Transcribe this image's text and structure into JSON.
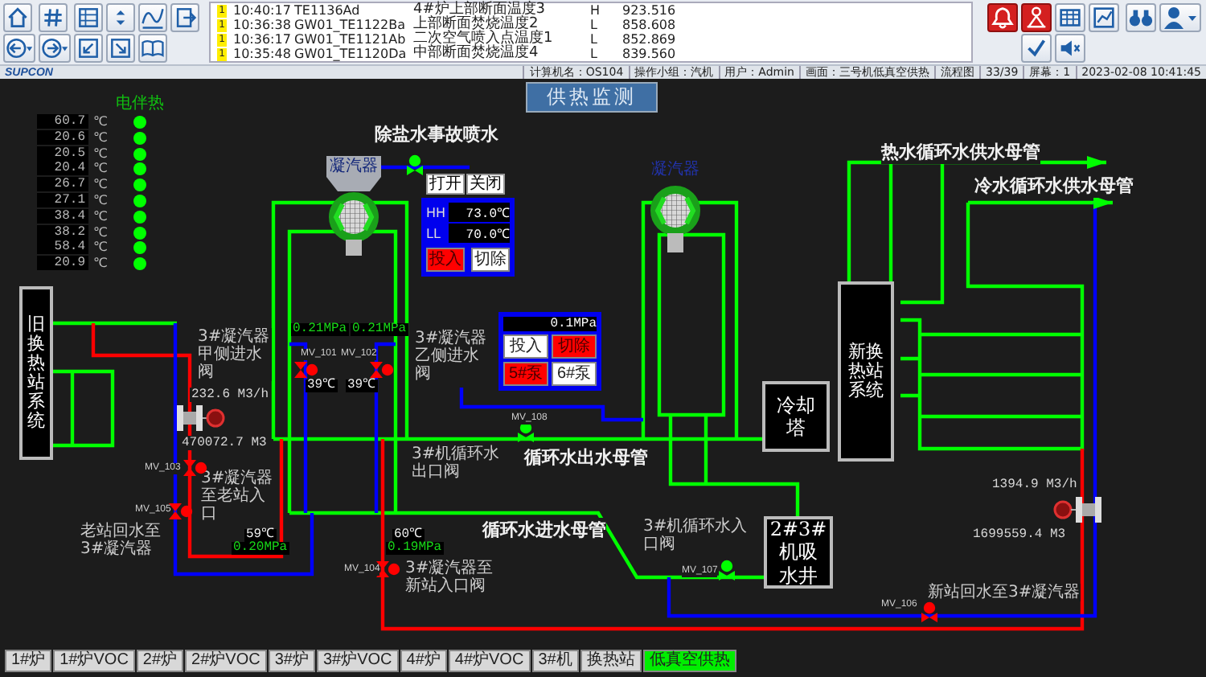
{
  "alarm_controls": [
    {
      "alert": true
    },
    {
      "alert": true
    }
  ],
  "alarms": [
    {
      "badge": "1",
      "time": "10:40:17",
      "tag": "TE1136Ad",
      "description": "4#炉上部断面温度3",
      "type": "H",
      "value": "923.516"
    },
    {
      "badge": "1",
      "time": "10:36:38",
      "tag": "GW01_TE1122Ba",
      "description": "上部断面焚烧温度2",
      "type": "L",
      "value": "858.608"
    },
    {
      "badge": "1",
      "time": "10:36:17",
      "tag": "GW01_TE1121Ab",
      "description": "二次空气喷入点温度1",
      "type": "L",
      "value": "852.869"
    },
    {
      "badge": "1",
      "time": "10:35:48",
      "tag": "GW01_TE1120Da",
      "description": "中部断面焚烧温度4",
      "type": "L",
      "value": "839.560"
    }
  ],
  "status_bar": {
    "logo": "SUPCON",
    "fields": [
      "计算机名：OS104",
      "操作小组：汽机",
      "用户：Admin",
      "画面：三号机低真空供热",
      "流程图",
      "33/39",
      "屏幕：1",
      "2023-02-08 10:41:45"
    ]
  },
  "diagram": {
    "title": "供热监测",
    "temperatures": [
      {
        "value": "60.7",
        "unit": "℃"
      },
      {
        "value": "20.6",
        "unit": "℃"
      },
      {
        "value": "20.5",
        "unit": "℃"
      },
      {
        "value": "20.4",
        "unit": "℃"
      },
      {
        "value": "26.7",
        "unit": "℃"
      },
      {
        "value": "27.1",
        "unit": "℃"
      },
      {
        "value": "38.4",
        "unit": "℃"
      },
      {
        "value": "38.2",
        "unit": "℃"
      },
      {
        "value": "58.4",
        "unit": "℃"
      },
      {
        "value": "20.9",
        "unit": "℃"
      }
    ],
    "heat_trace": {
      "label": "电伴热",
      "indicators": [
        {
          "on": true
        },
        {
          "on": true
        },
        {
          "on": true
        },
        {
          "on": true
        },
        {
          "on": true
        },
        {
          "on": true
        },
        {
          "on": true
        },
        {
          "on": true
        },
        {
          "on": true
        },
        {
          "on": true
        }
      ]
    },
    "condensers": [
      {
        "label": "凝汽器"
      },
      {
        "label": "凝汽器"
      }
    ],
    "stations": [
      {
        "label": "旧换热站系统",
        "kind": "vertical"
      },
      {
        "label": "新换热站系统",
        "kind": "vertical"
      },
      {
        "label": "冷却塔",
        "kind": "box"
      },
      {
        "label": "2#3#机吸水井",
        "kind": "box"
      }
    ],
    "pipe_labels": [
      "除盐水事故喷水",
      "热水循环水供水母管",
      "冷水循环水供水母管",
      "循环水出水母管",
      "循环水进水母管"
    ],
    "notes": [
      "3#凝汽器甲侧进水阀",
      "3#凝汽器乙侧进水阀",
      "3#机循环水出口阀",
      "3#凝汽器至老站入口",
      "老站回水至3#凝汽器",
      "3#凝汽器至新站入口阀",
      "3#机循环水入口阀",
      "新站回水至3#凝汽器"
    ],
    "valves": [
      {
        "color": "#00ff00"
      },
      {
        "tag": "MV_101",
        "color": "#ff0000"
      },
      {
        "tag": "MV_102",
        "color": "#ff0000"
      },
      {
        "tag": "MV_103",
        "color": "#ff0000"
      },
      {
        "tag": "MV_105",
        "color": "#ff0000"
      },
      {
        "tag": "MV_104",
        "color": "#ff0000"
      },
      {
        "tag": "MV_108",
        "color": "#00ff00"
      },
      {
        "tag": "MV_107",
        "color": "#00ff00"
      },
      {
        "tag": "MV_106",
        "color": "#ff0000"
      }
    ],
    "readings": [
      {
        "text": "0.21MPa",
        "kind": "pressure"
      },
      {
        "text": "0.21MPa",
        "kind": "pressure"
      },
      {
        "text": "39℃",
        "kind": "temperature"
      },
      {
        "text": "39℃",
        "kind": "temperature"
      },
      {
        "text": "232.6 M3/h",
        "kind": "flow"
      },
      {
        "text": "470072.7 M3",
        "kind": "flow"
      },
      {
        "text": "59℃",
        "kind": "temperature"
      },
      {
        "text": "0.20MPa",
        "kind": "pressure"
      },
      {
        "text": "60℃",
        "kind": "temperature"
      },
      {
        "text": "0.19MPa",
        "kind": "pressure"
      },
      {
        "text": "1394.9 M3/h",
        "kind": "flow"
      },
      {
        "text": "1699559.4 M3",
        "kind": "flow"
      }
    ],
    "spray_buttons": [
      "打开",
      "关闭"
    ],
    "limit_panel": {
      "limits": [
        {
          "label": "HH",
          "value": "73.0℃"
        },
        {
          "label": "LL",
          "value": "70.0℃"
        }
      ],
      "buttons": [
        {
          "label": "投入",
          "selected": true
        },
        {
          "label": "切除",
          "selected": false
        }
      ]
    },
    "pump_panel": {
      "reading": "0.1MPa",
      "buttons": [
        {
          "label": "投入",
          "selected": false
        },
        {
          "label": "切除",
          "selected": true
        },
        {
          "label": "5#泵",
          "selected": true
        },
        {
          "label": "6#泵",
          "selected": false
        }
      ]
    }
  },
  "tabs": [
    {
      "label": "1#炉",
      "selected": false
    },
    {
      "label": "1#炉VOC",
      "selected": false
    },
    {
      "label": "2#炉",
      "selected": false
    },
    {
      "label": "2#炉VOC",
      "selected": false
    },
    {
      "label": "3#炉",
      "selected": false
    },
    {
      "label": "3#炉VOC",
      "selected": false
    },
    {
      "label": "4#炉",
      "selected": false
    },
    {
      "label": "4#炉VOC",
      "selected": false
    },
    {
      "label": "3#机",
      "selected": false
    },
    {
      "label": "换热站",
      "selected": false
    },
    {
      "label": "低真空供热",
      "selected": true
    }
  ]
}
